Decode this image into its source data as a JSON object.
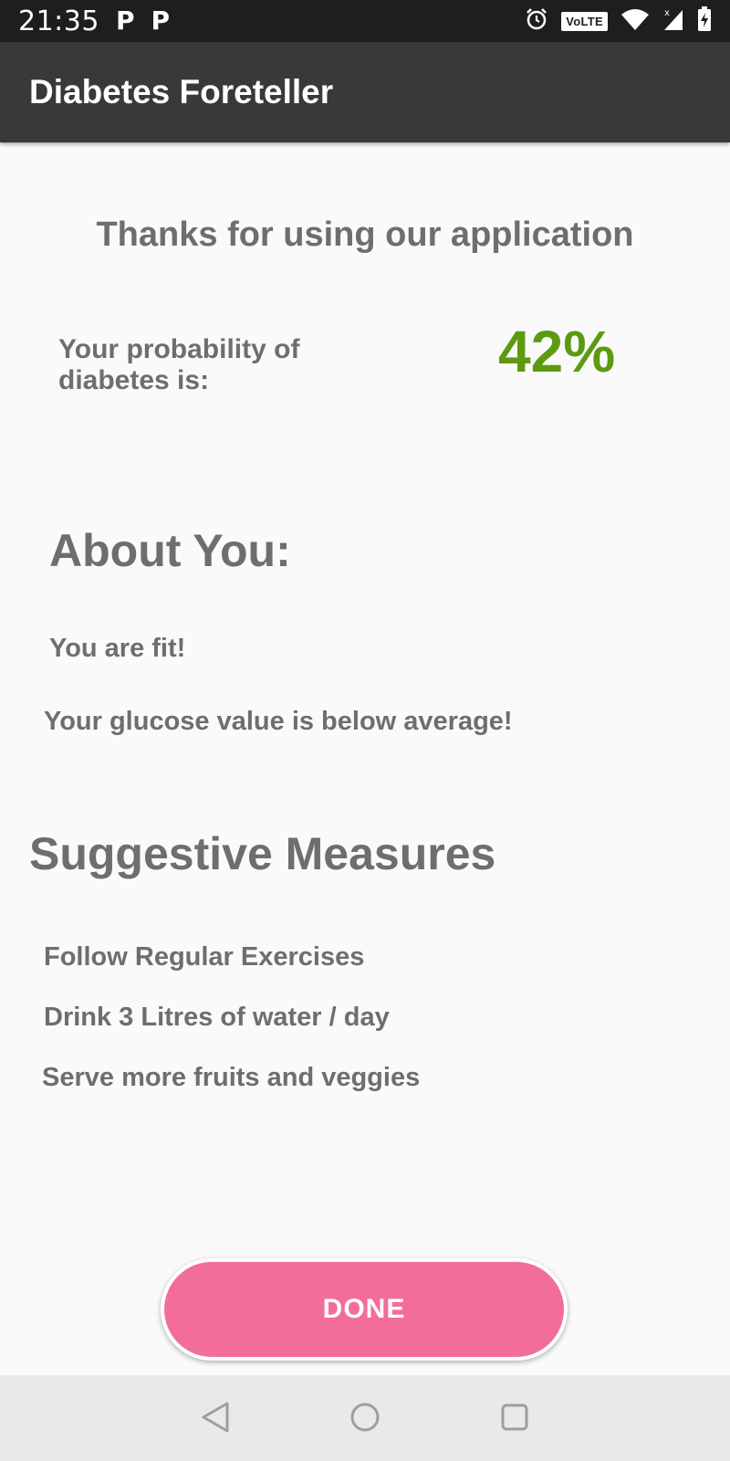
{
  "status_bar": {
    "time": "21:35",
    "notif_1": "P",
    "notif_2": "P",
    "volte": "VoLTE",
    "icons": [
      "alarm-icon",
      "volte-icon",
      "wifi-icon",
      "signal-icon",
      "battery-charging-icon"
    ]
  },
  "app_bar": {
    "title": "Diabetes Foreteller"
  },
  "main": {
    "thanks": "Thanks for using our application",
    "probability_label": "Your probability of diabetes is:",
    "probability_value": "42%",
    "about_heading": "About You:",
    "about_lines": [
      "You are fit!",
      "Your glucose value is below average!"
    ],
    "measures_heading": "Suggestive Measures",
    "measures": [
      "Follow Regular Exercises",
      "Drink 3 Litres of water / day",
      "Serve more fruits and veggies"
    ]
  },
  "done_button": {
    "label": "DONE"
  },
  "nav_bar": {
    "icons": [
      "back-icon",
      "home-icon",
      "recents-icon"
    ]
  },
  "colors": {
    "app_bar": "#393939",
    "status_bar": "#1e1e1e",
    "probability": "#5e9a10",
    "done_button": "#f26d9c",
    "text": "#6e6e6e"
  }
}
